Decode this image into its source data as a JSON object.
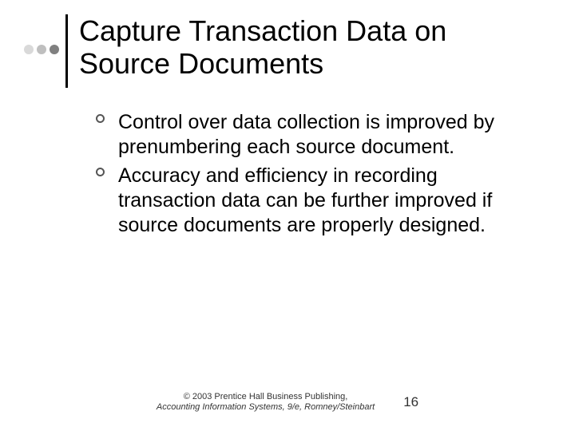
{
  "slide": {
    "title": "Capture Transaction Data on Source Documents",
    "bullets": [
      "Control over data collection is improved by prenumbering each source document.",
      "Accuracy and efficiency in recording transaction data can be further improved if source documents are properly designed."
    ]
  },
  "footer": {
    "copyright_line1": "© 2003 Prentice Hall Business Publishing,",
    "copyright_line2": "Accounting Information Systems, 9/e, Romney/Steinbart",
    "page_number": "16"
  }
}
